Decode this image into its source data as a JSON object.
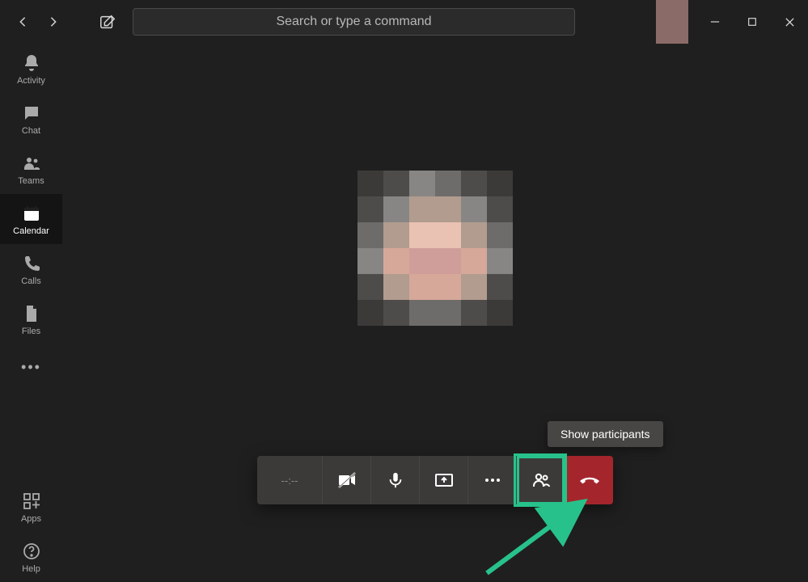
{
  "colors": {
    "background": "#1f1f1f",
    "toolbar": "#3b3a39",
    "hangup": "#a4262c",
    "highlight": "#27c28b",
    "tooltip_bg": "#484644"
  },
  "search": {
    "placeholder": "Search or type a command"
  },
  "rail": {
    "items": [
      {
        "label": "Activity",
        "icon": "bell-icon",
        "active": false
      },
      {
        "label": "Chat",
        "icon": "chat-icon",
        "active": false
      },
      {
        "label": "Teams",
        "icon": "teams-icon",
        "active": false
      },
      {
        "label": "Calendar",
        "icon": "calendar-icon",
        "active": true
      },
      {
        "label": "Calls",
        "icon": "calls-icon",
        "active": false
      },
      {
        "label": "Files",
        "icon": "files-icon",
        "active": false
      }
    ],
    "bottom": [
      {
        "label": "Apps",
        "icon": "apps-icon"
      },
      {
        "label": "Help",
        "icon": "help-icon"
      }
    ]
  },
  "call": {
    "timer": "--:--",
    "tooltip": "Show participants"
  }
}
